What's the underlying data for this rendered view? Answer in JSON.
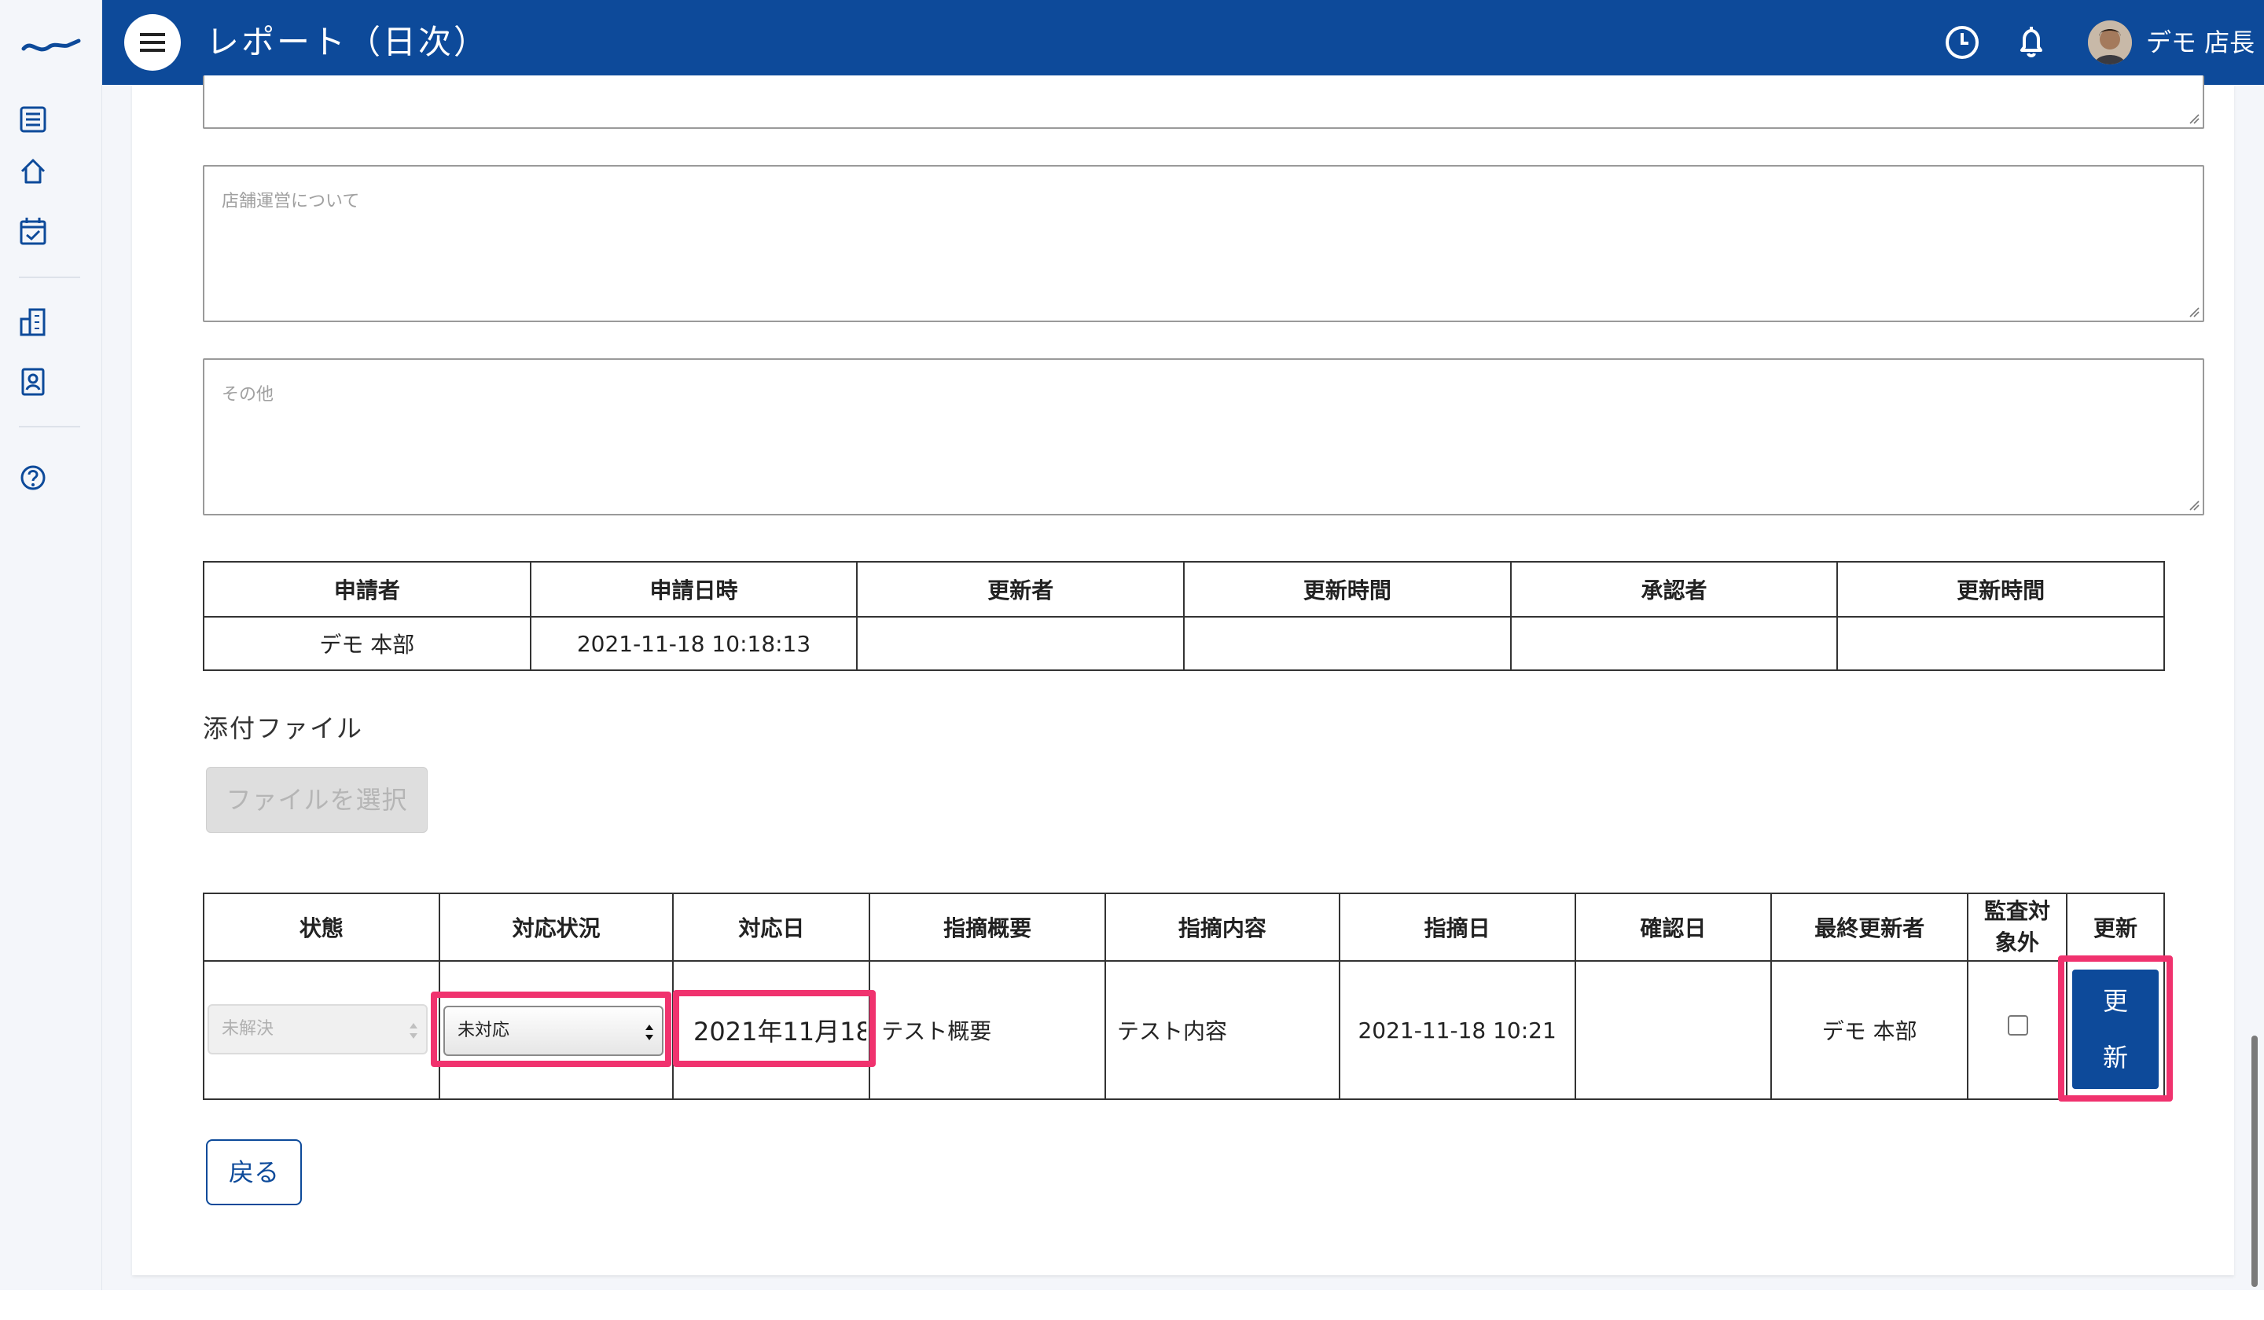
{
  "header": {
    "title": "レポート（日次）",
    "user_name": "デモ 店長",
    "bg_color": "#0d4a9a"
  },
  "sidebar": {
    "items": [
      {
        "icon": "list-icon"
      },
      {
        "icon": "home-icon"
      },
      {
        "icon": "calendar-check-icon"
      },
      {
        "icon": "building-icon"
      },
      {
        "icon": "id-card-icon"
      },
      {
        "icon": "help-icon"
      }
    ]
  },
  "form": {
    "store_operation_placeholder": "店舗運営について",
    "other_placeholder": "その他"
  },
  "approval_table": {
    "headers": [
      "申請者",
      "申請日時",
      "更新者",
      "更新時間",
      "承認者",
      "更新時間"
    ],
    "row": [
      "デモ 本部",
      "2021-11-18 10:18:13",
      "",
      "",
      "",
      ""
    ]
  },
  "attachments": {
    "label": "添付ファイル",
    "select_button": "ファイルを選択"
  },
  "findings_table": {
    "headers": {
      "status": "状態",
      "response_status": "対応状況",
      "response_date": "対応日",
      "summary": "指摘概要",
      "content": "指摘内容",
      "finding_date": "指摘日",
      "confirm_date": "確認日",
      "last_updater": "最終更新者",
      "audit_exclude": "監査対象外",
      "update": "更新"
    },
    "row": {
      "status": "未解決",
      "response_status": "未対応",
      "response_date": "2021年11月18",
      "summary": "テスト概要",
      "content": "テスト内容",
      "finding_date": "2021-11-18 10:21",
      "confirm_date": "",
      "last_updater": "デモ 本部",
      "audit_exclude_checked": false,
      "update_button": "更新"
    }
  },
  "update_button_chars": [
    "更",
    "新"
  ],
  "back_button": "戻る",
  "highlight_color": "#f0326e"
}
